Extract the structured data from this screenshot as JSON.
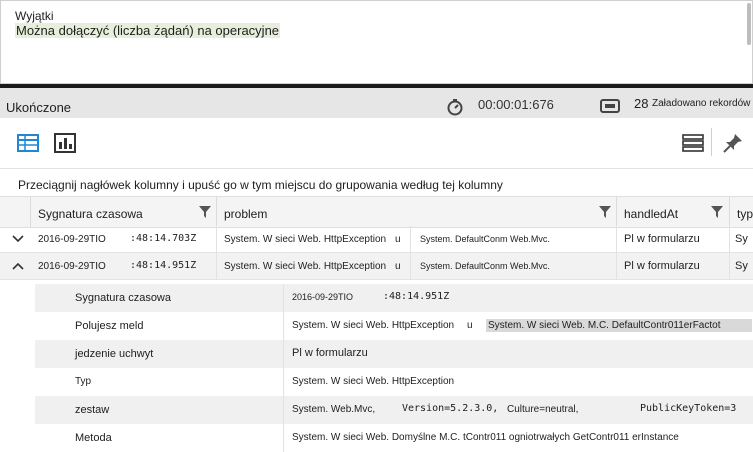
{
  "editor": {
    "line1": "Wyjątki",
    "line2": "Można dołączyć (liczba żądań) na operacyjne"
  },
  "status": {
    "state": "Ukończone",
    "elapsed": "00:00:01:676",
    "records_count": "28",
    "records_label": "Załadowano rekordów"
  },
  "toolbar": {
    "table_view": "table-icon",
    "chart_view": "chart-icon",
    "columns": "columns-icon",
    "pin": "pin-icon"
  },
  "group_hint": "Przeciągnij nagłówek kolumny i upuść go w tym miejscu do grupowania według tej kolumny",
  "columns": [
    "Sygnatura czasowa",
    "problem",
    "handledAt",
    "typ"
  ],
  "rows": [
    {
      "date": "2016-09-29TIO",
      "time": ":48:14.703Z",
      "problem_a": "System. W sieci Web. HttpException",
      "problem_u": "u",
      "problem_b": "System. DefaultConm Web.Mvc.",
      "handledAt": "Pl w formularzu",
      "typ": "Sy"
    },
    {
      "date": "2016-09-29TIO",
      "time": ":48:14.951Z",
      "problem_a": "System. W sieci Web. HttpException",
      "problem_u": "u",
      "problem_b": "System. DefaultConm Web.Mvc.",
      "handledAt": "Pl w formularzu",
      "typ": "Sy"
    }
  ],
  "details": [
    {
      "label": "Sygnatura czasowa",
      "v1": "2016-09-29TIO",
      "v2": ":48:14.951Z"
    },
    {
      "label": "Polujesz meld",
      "v1": "System. W sieci Web. HttpException",
      "v2": "u",
      "v3": "System. W sieci Web. M.C. DefaultContr011erFactot"
    },
    {
      "label": "jedzenie uchwyt",
      "v1": "Pl w formularzu"
    },
    {
      "label": "Typ",
      "v1": "System. W sieci Web. HttpException"
    },
    {
      "label": "zestaw",
      "v1": "System. Web.Mvc,",
      "v2": "Version=5.2.3.0,",
      "v3": "Culture=neutral,",
      "v4": "PublicKeyToken=3"
    },
    {
      "label": "Metoda",
      "v1": "System. W sieci Web. Domyślne M.C. tContr011 ogniotrwałych GetContr011 erInstance"
    }
  ]
}
